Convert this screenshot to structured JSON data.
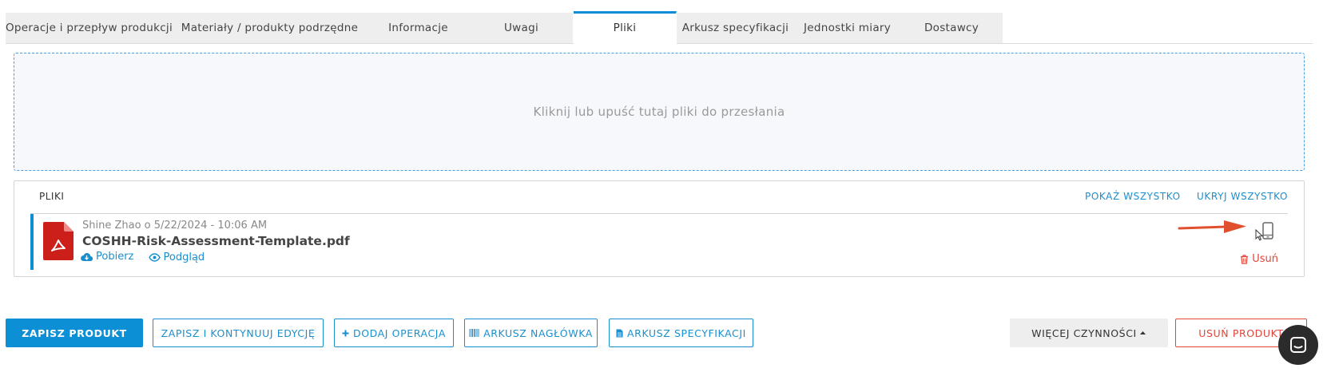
{
  "tabs": [
    {
      "label": "Operacje i przepływ produkcji"
    },
    {
      "label": "Materiały / produkty podrzędne"
    },
    {
      "label": "Informacje"
    },
    {
      "label": "Uwagi"
    },
    {
      "label": "Pliki",
      "active": true
    },
    {
      "label": "Arkusz specyfikacji"
    },
    {
      "label": "Jednostki miary"
    },
    {
      "label": "Dostawcy"
    }
  ],
  "dropzone": {
    "text": "Kliknij lub upuść tutaj pliki do przesłania"
  },
  "files": {
    "title": "PLIKI",
    "show_all": "POKAŻ WSZYSTKO",
    "hide_all": "UKRYJ WSZYSTKO",
    "items": [
      {
        "meta": "Shine Zhao o 5/22/2024 - 10:06 AM",
        "name": "COSHH-Risk-Assessment-Template.pdf",
        "download": "Pobierz",
        "preview": "Podgląd",
        "delete": "Usuń",
        "icon": "pdf-icon"
      }
    ]
  },
  "buttons": {
    "save": "ZAPISZ PRODUKT",
    "save_continue": "ZAPISZ I KONTYNUUJ EDYCJĘ",
    "add_operation": "DODAJ OPERACJA",
    "header_sheet": "ARKUSZ NAGŁÓWKA",
    "spec_sheet": "ARKUSZ SPECYFIKACJI",
    "more_actions": "WIĘCEJ CZYNNOŚCI",
    "delete_product": "USUŃ PRODUKT"
  },
  "colors": {
    "accent": "#0d8fd6",
    "danger": "#e2453a",
    "pdf": "#cc1f1a",
    "arrow": "#e0502f"
  }
}
